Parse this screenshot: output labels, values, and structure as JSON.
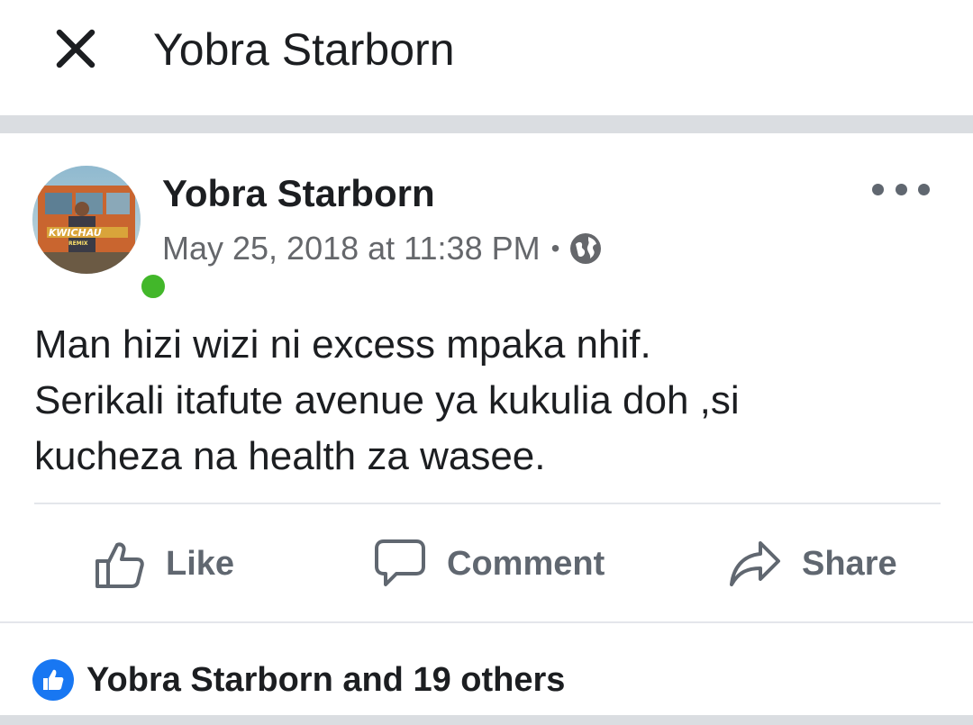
{
  "header": {
    "title": "Yobra Starborn",
    "close_icon": "close-icon"
  },
  "post": {
    "author": "Yobra Starborn",
    "avatar_text": "KWICHAU",
    "avatar_subtext": "REMIX",
    "online": true,
    "timestamp": "May 25, 2018 at 11:38 PM",
    "separator": "•",
    "audience_icon": "globe-icon",
    "more_icon": "more-dots-icon",
    "text_lines": [
      "Man hizi wizi ni excess mpaka nhif.",
      "Serikali itafute avenue ya kukulia doh ,si",
      "kucheza na health za wasee."
    ]
  },
  "actions": {
    "like_label": "Like",
    "comment_label": "Comment",
    "share_label": "Share"
  },
  "reactions": {
    "summary": "Yobra Starborn and 19 others",
    "icon": "like-badge-icon"
  },
  "colors": {
    "online": "#42b72a",
    "like_blue": "#1877f2",
    "muted": "#606770",
    "separator": "#dadde1"
  }
}
